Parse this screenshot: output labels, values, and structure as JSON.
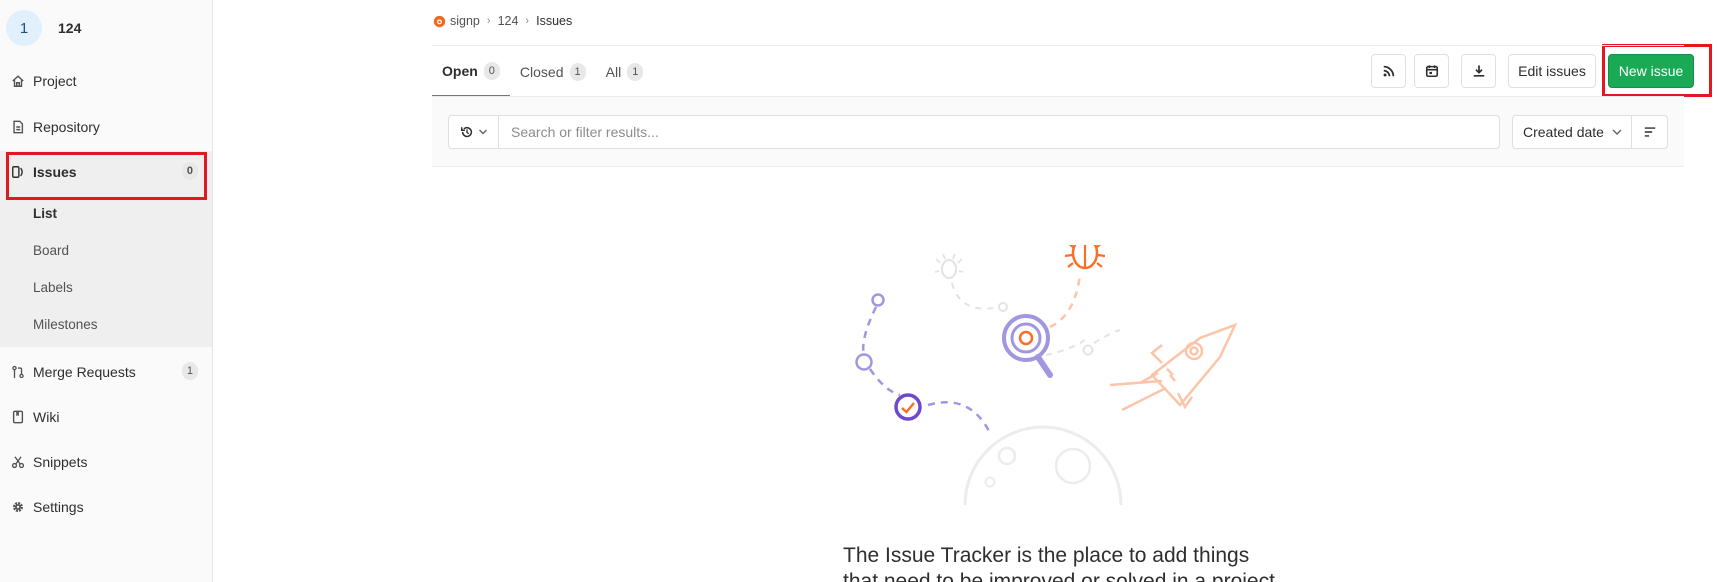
{
  "sidebar": {
    "avatar_letter": "1",
    "project_name": "124",
    "items": [
      {
        "label": "Project",
        "icon": "home-icon"
      },
      {
        "label": "Repository",
        "icon": "doc-icon"
      },
      {
        "label": "Issues",
        "icon": "issues-icon",
        "count": "0"
      },
      {
        "label": "Merge Requests",
        "icon": "merge-request-icon",
        "count": "1"
      },
      {
        "label": "Wiki",
        "icon": "book-icon"
      },
      {
        "label": "Snippets",
        "icon": "scissors-icon"
      },
      {
        "label": "Settings",
        "icon": "gear-icon"
      }
    ],
    "issues_sub": [
      "List",
      "Board",
      "Labels",
      "Milestones"
    ]
  },
  "breadcrumb": {
    "group": "signp",
    "project": "124",
    "current": "Issues"
  },
  "tabs": [
    {
      "label": "Open",
      "count": "0"
    },
    {
      "label": "Closed",
      "count": "1"
    },
    {
      "label": "All",
      "count": "1"
    }
  ],
  "actions": {
    "rss": "rss-icon",
    "calendar": "calendar-icon",
    "export": "download-icon",
    "edit_label": "Edit issues",
    "new_label": "New issue"
  },
  "filter": {
    "placeholder": "Search or filter results...",
    "sort_label": "Created date"
  },
  "empty_state": {
    "text": "The Issue Tracker is the place to add things that need to be improved or solved in a project"
  },
  "colors": {
    "accent": "#6b6acb",
    "primary": "#1aaa55",
    "highlight": "#e2171f"
  }
}
